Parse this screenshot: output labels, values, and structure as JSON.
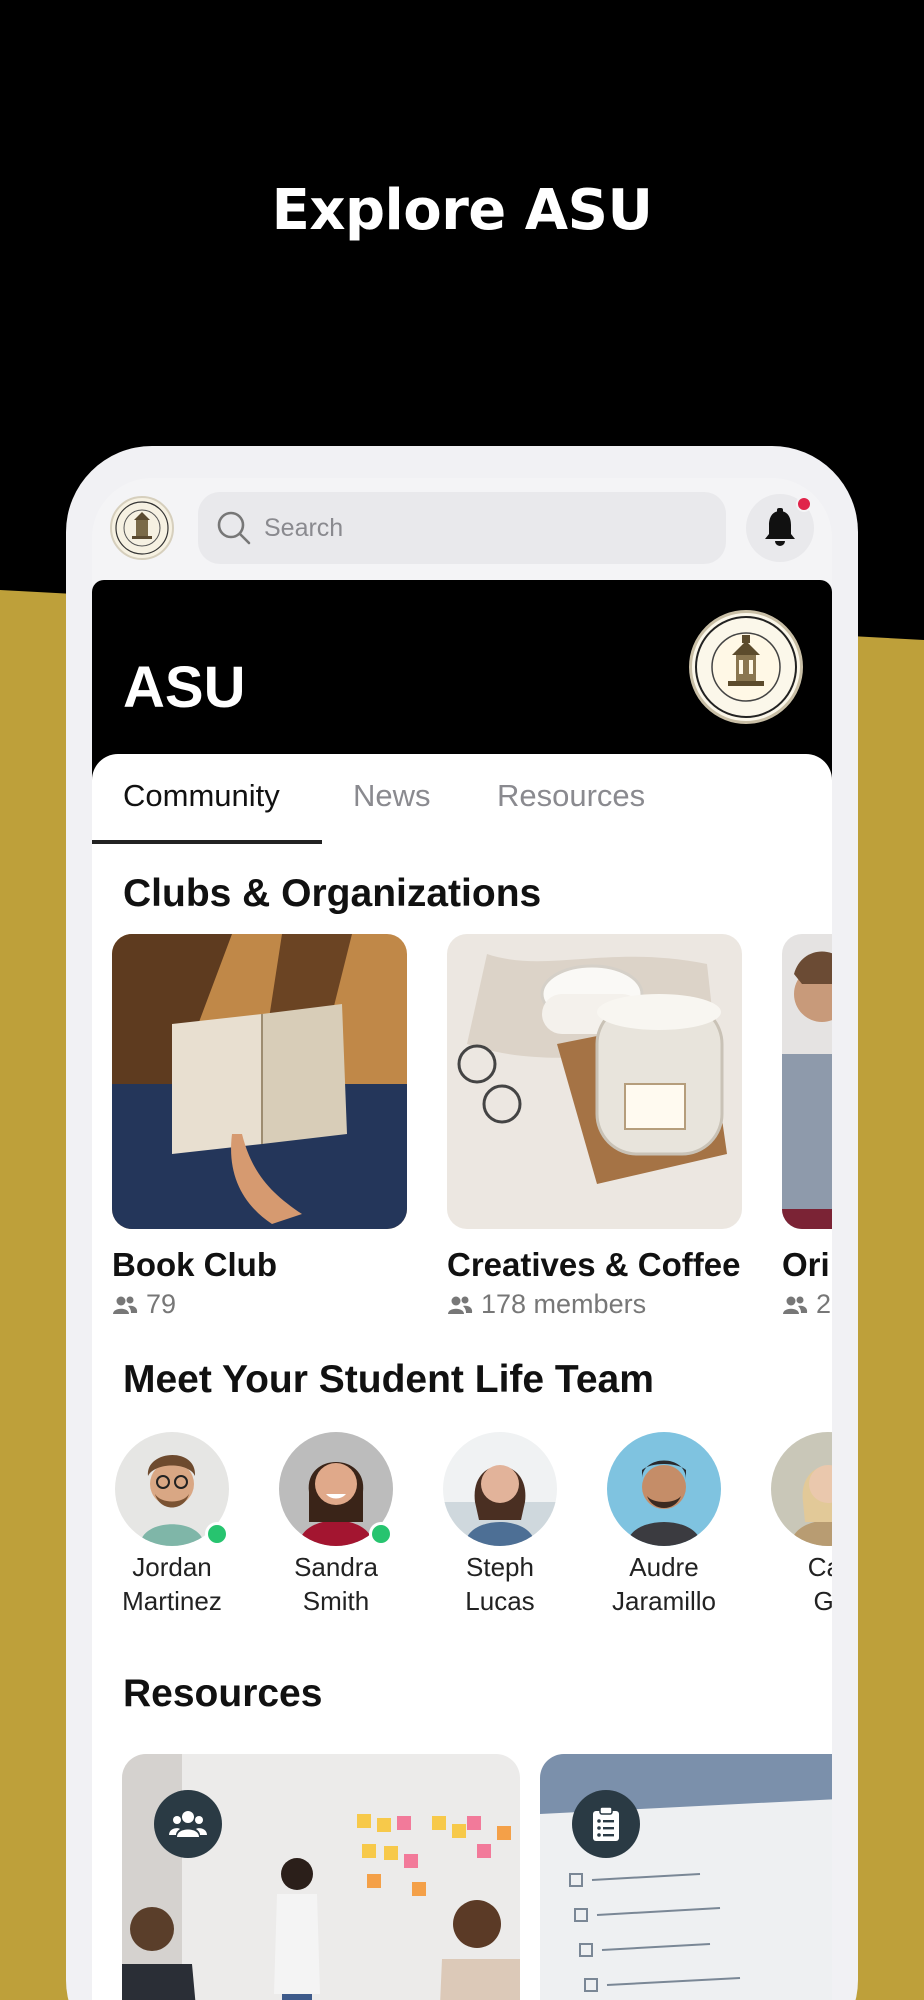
{
  "hero": {
    "title": "Explore ASU"
  },
  "colors": {
    "gold": "#bea03a",
    "black": "#000000",
    "online": "#27c46f",
    "notification": "#e0244a"
  },
  "topbar": {
    "search_placeholder": "Search",
    "icons": [
      "asu-seal-icon",
      "search-icon",
      "bell-icon"
    ]
  },
  "header": {
    "title": "ASU"
  },
  "tabs": [
    {
      "label": "Community",
      "active": true
    },
    {
      "label": "News",
      "active": false
    },
    {
      "label": "Resources",
      "active": false
    }
  ],
  "clubs": {
    "title": "Clubs & Organizations",
    "items": [
      {
        "name": "Book Club",
        "members": "79"
      },
      {
        "name": "Creatives & Coffee",
        "members": "178 members"
      },
      {
        "name": "Ori",
        "members": "2"
      }
    ]
  },
  "team": {
    "title": "Meet Your Student Life Team",
    "people": [
      {
        "first": "Jordan",
        "last": "Martinez",
        "online": true
      },
      {
        "first": "Sandra",
        "last": "Smith",
        "online": true
      },
      {
        "first": "Steph",
        "last": "Lucas",
        "online": false
      },
      {
        "first": "Audre",
        "last": "Jaramillo",
        "online": false
      },
      {
        "first": "Cat",
        "last": "Gr",
        "online": false
      }
    ]
  },
  "resources": {
    "title": "Resources"
  }
}
